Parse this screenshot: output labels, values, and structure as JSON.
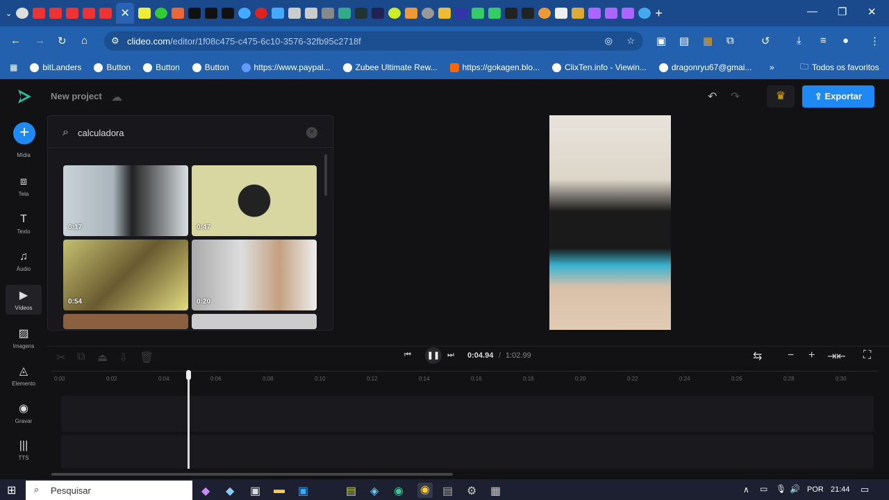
{
  "browser": {
    "url_host": "clideo.com",
    "url_path": "/editor/1f08c475-c475-6c10-3576-32fb95c2718f",
    "bookmarks": [
      "bitLanders",
      "Button",
      "Button",
      "Button",
      "https://www.paypal...",
      "Zubee Ultimate Rew...",
      "https://gokagen.blo...",
      "ClixTen.info - Viewin...",
      "dragonryu67@gmai..."
    ],
    "all_bookmarks": "Todos os favoritos"
  },
  "app": {
    "project_name": "New project",
    "export_label": "Exportar",
    "rail": [
      {
        "label": "Mídia",
        "icon": "plus-icon"
      },
      {
        "label": "Tela",
        "icon": "canvas-icon"
      },
      {
        "label": "Texto",
        "icon": "text-icon"
      },
      {
        "label": "Áudio",
        "icon": "music-icon"
      },
      {
        "label": "Vídeos",
        "icon": "video-icon"
      },
      {
        "label": "Imagens",
        "icon": "image-icon"
      },
      {
        "label": "Elemento",
        "icon": "shapes-icon"
      },
      {
        "label": "Gravar",
        "icon": "record-icon"
      },
      {
        "label": "TTS",
        "icon": "waveform-icon"
      }
    ],
    "search_value": "calculadora",
    "results": [
      {
        "duration": "0:17"
      },
      {
        "duration": "0:47"
      },
      {
        "duration": "0:54"
      },
      {
        "duration": "0:20"
      }
    ],
    "current_time": "0:04.94",
    "total_time": "1:02.99",
    "ruler": [
      "0:00",
      "0:02",
      "0:04",
      "0:06",
      "0:08",
      "0:10",
      "0:12",
      "0:14",
      "0:16",
      "0:18",
      "0:20",
      "0:22",
      "0:24",
      "0:26",
      "0:28",
      "0:30"
    ]
  },
  "taskbar": {
    "search_placeholder": "Pesquisar",
    "lang": "POR",
    "time": "21:44"
  }
}
